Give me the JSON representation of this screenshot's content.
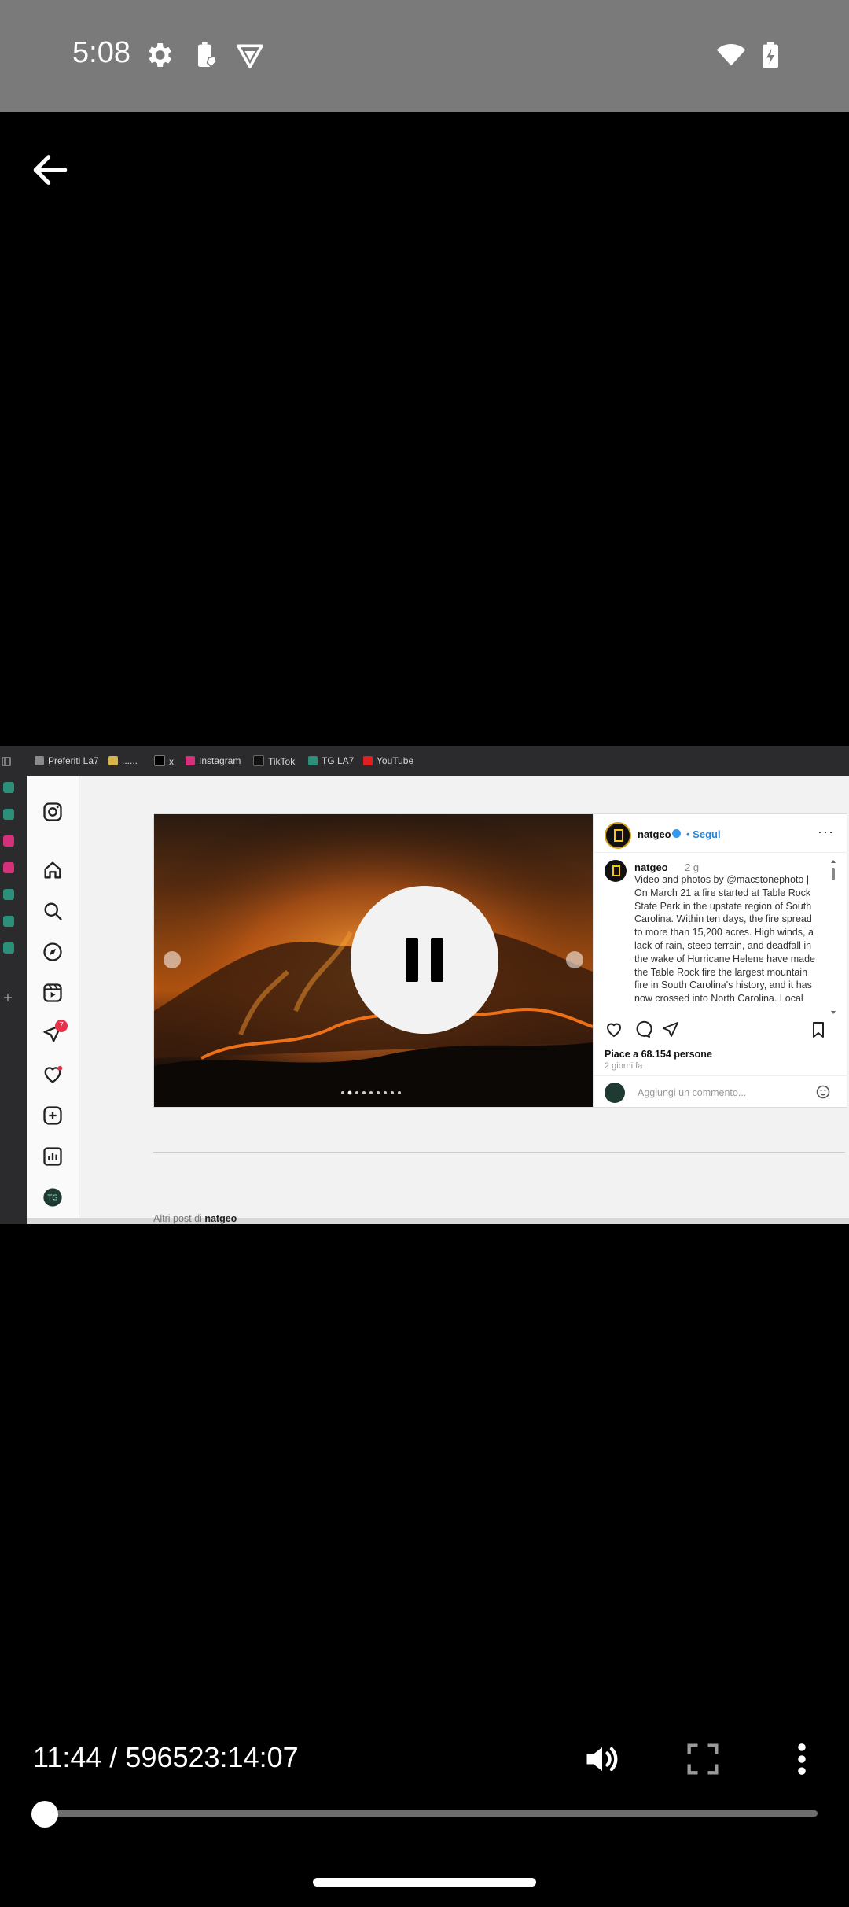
{
  "status_bar": {
    "time": "5:08",
    "icons": [
      "gear-icon",
      "battery-saver-icon",
      "vpn-shield-icon",
      "wifi-icon",
      "battery-charging-icon"
    ]
  },
  "player": {
    "back_icon": "arrow-left-icon",
    "state": "playing",
    "center_control_icon": "pause-icon",
    "time_display": "11:44 / 596523:14:07",
    "progress_fraction": 0.01,
    "controls": [
      "volume-icon",
      "fullscreen-icon",
      "more-vert-icon"
    ]
  },
  "video_frame": {
    "bookmarks": [
      {
        "label": "Preferiti La7",
        "icon": "folder-icon"
      },
      {
        "label": "......",
        "icon": "la7-icon"
      },
      {
        "label": "x",
        "icon": "x-logo-icon"
      },
      {
        "label": "Instagram",
        "icon": "instagram-icon"
      },
      {
        "label": "TikTok",
        "icon": "tiktok-icon"
      },
      {
        "label": "TG LA7",
        "icon": "tgla7-icon"
      },
      {
        "label": "YouTube",
        "icon": "youtube-icon"
      }
    ],
    "instagram": {
      "nav_icons": [
        "instagram-logo-icon",
        "home-icon",
        "search-icon",
        "explore-icon",
        "reels-icon",
        "messages-icon",
        "notifications-icon",
        "create-icon",
        "dashboard-icon",
        "profile-icon"
      ],
      "messages_badge": "7",
      "post": {
        "username": "natgeo",
        "follow_label": "Segui",
        "caption_user": "natgeo",
        "caption_age": "2 g",
        "caption": "Video and photos by @macstonephoto | On March 21 a fire started at Table Rock State Park in the upstate region of South Carolina. Within ten days, the fire spread to more than 15,200 acres. High winds, a lack of rain, steep terrain, and deadfall in the wake of Hurricane Helene have made the Table Rock fire the largest mountain fire in South Carolina's history, and it has now crossed into North Carolina. Local fire",
        "likes": "Piace a 68.154 persone",
        "posted_ago": "2 giorni fa",
        "comment_placeholder": "Aggiungi un commento...",
        "carousel_dots": 9,
        "carousel_active": 1
      },
      "more_posts_prefix": "Altri post di",
      "more_posts_user": "natgeo"
    }
  }
}
